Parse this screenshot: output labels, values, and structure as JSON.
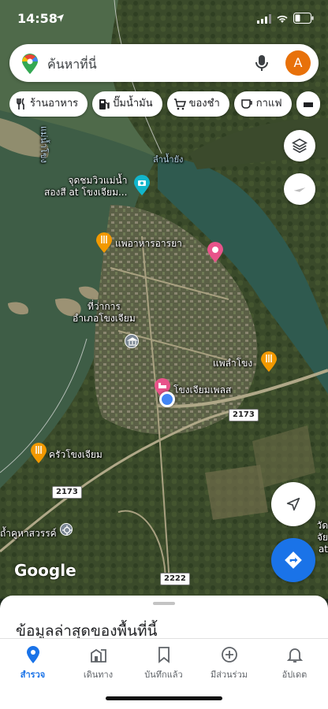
{
  "status_bar": {
    "time": "14:58"
  },
  "search": {
    "placeholder": "ค้นหาที่นี่",
    "avatar_letter": "A"
  },
  "chips": [
    {
      "icon": "restaurant-icon",
      "label": "ร้านอาหาร"
    },
    {
      "icon": "gas-station-icon",
      "label": "ปั๊มน้ำมัน"
    },
    {
      "icon": "cart-icon",
      "label": "ของชำ"
    },
    {
      "icon": "coffee-icon",
      "label": "กาแฟ"
    }
  ],
  "map_labels": {
    "river_mekong": "แม่น้ำโขง",
    "river_mun": "ลำน้ำยัง",
    "viewpoint": "จุดชมวิวแม่น้ำ\nสองสี at โขงเจียม...",
    "raft_restaurant": "แพอาหารอารยา",
    "district_office": "ที่ว่าการ\nอำเภอโขงเจียม",
    "pae_lam_khong": "แพลำโขง",
    "hotel": "โขงเจียมเพลส",
    "krua_khong": "ครัวโขงเจียม",
    "temple": "ถ้ำคูหาสวรรค์",
    "wat_edge": "วัด\nจัย at",
    "road_2173_a": "2173",
    "road_2173_b": "2173",
    "road_2222": "2222",
    "google": "Google"
  },
  "sheet": {
    "title": "ข้อมูลล่าสุดของพื้นที่นี้"
  },
  "bottom_nav": [
    {
      "icon": "explore-pin-icon",
      "label": "สำรวจ",
      "active": true
    },
    {
      "icon": "commute-icon",
      "label": "เดินทาง",
      "active": false
    },
    {
      "icon": "bookmark-icon",
      "label": "บันทึกแล้ว",
      "active": false
    },
    {
      "icon": "add-circle-icon",
      "label": "มีส่วนร่วม",
      "active": false
    },
    {
      "icon": "bell-icon",
      "label": "อัปเดต",
      "active": false
    }
  ],
  "colors": {
    "accent": "#1a73e8",
    "avatar": "#e8710a",
    "river": "#2f5a4f",
    "land": "#3b4a2c"
  }
}
